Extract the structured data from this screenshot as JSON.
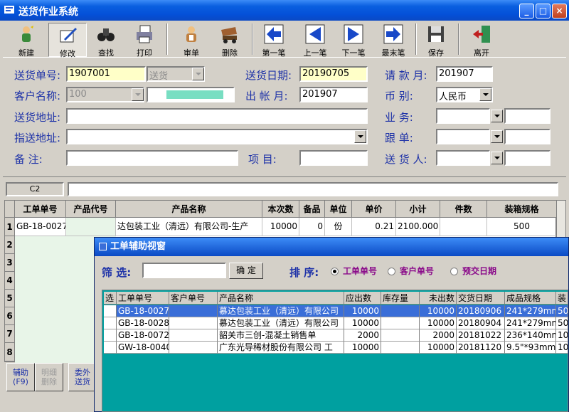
{
  "window": {
    "title": "送货作业系统"
  },
  "toolbar": [
    {
      "key": "new",
      "label": "新建"
    },
    {
      "key": "edit",
      "label": "修改"
    },
    {
      "key": "find",
      "label": "查找"
    },
    {
      "key": "print",
      "label": "打印"
    },
    {
      "key": "audit",
      "label": "审单"
    },
    {
      "key": "delete",
      "label": "删除"
    },
    {
      "key": "first",
      "label": "第一笔"
    },
    {
      "key": "prev",
      "label": "上一笔"
    },
    {
      "key": "next",
      "label": "下一笔"
    },
    {
      "key": "last",
      "label": "最末笔"
    },
    {
      "key": "save",
      "label": "保存"
    },
    {
      "key": "exit",
      "label": "离开"
    }
  ],
  "form": {
    "delivery_no": {
      "label": "送货单号:",
      "value": "1907001"
    },
    "delivery_type": {
      "value": "送货"
    },
    "delivery_date": {
      "label": "送货日期:",
      "value": "20190705"
    },
    "billing_month": {
      "label": "请 款 月:",
      "value": "201907"
    },
    "customer": {
      "label": "客户名称:",
      "value": "100"
    },
    "invoice_month": {
      "label": "出 帐 月:",
      "value": "201907"
    },
    "currency": {
      "label": "币    别:",
      "value": "人民币"
    },
    "delivery_address": {
      "label": "送货地址:",
      "value": ""
    },
    "sales": {
      "label": "业    务:",
      "value": ""
    },
    "assigned_address": {
      "label": "指送地址:",
      "value": ""
    },
    "follow": {
      "label": "跟    单:",
      "value": ""
    },
    "remark": {
      "label": "备    注:",
      "value": ""
    },
    "project": {
      "label": "项    目:",
      "value": ""
    },
    "deliverer": {
      "label": "送 货 人:",
      "value": ""
    }
  },
  "cell_ref": "C2",
  "grid": {
    "columns": [
      "工单单号",
      "产品代号",
      "产品名称",
      "本次数",
      "备品",
      "单位",
      "单价",
      "小计",
      "件数",
      "装箱规格"
    ],
    "rows": [
      {
        "n": "1",
        "cells": [
          "GB-18-0027",
          "",
          "达包装工业（清远）有限公司-生产",
          "10000",
          "0",
          "份",
          "0.21",
          "2100.000",
          "",
          "500"
        ]
      },
      {
        "n": "2"
      },
      {
        "n": "3"
      },
      {
        "n": "4"
      },
      {
        "n": "5"
      },
      {
        "n": "6"
      },
      {
        "n": "7"
      },
      {
        "n": "8"
      }
    ]
  },
  "side_buttons": [
    {
      "l1": "辅助",
      "l2": "(F9)"
    },
    {
      "l1": "明细",
      "l2": "删除"
    },
    {
      "l1": "委外",
      "l2": "送货"
    }
  ],
  "popup": {
    "title": "工单辅助视窗",
    "filter_label": "筛  选:",
    "filter_value": "",
    "confirm": "确  定",
    "sort_label": "排  序:",
    "sort_options": [
      "工单单号",
      "客户单号",
      "预交日期"
    ],
    "columns": [
      "选",
      "工单单号",
      "客户单号",
      "产品名称",
      "应出数",
      "库存量",
      "未出数",
      "交货日期",
      "成品规格",
      "装"
    ],
    "rows": [
      [
        "",
        "GB-18-0027",
        "",
        "慕达包装工业（清远）有限公司",
        "10000",
        "",
        "10000",
        "20180906",
        "241*279mm",
        "50"
      ],
      [
        "",
        "GB-18-0028",
        "",
        "慕达包装工业（清远）有限公司",
        "10000",
        "",
        "10000",
        "20180904",
        "241*279mm",
        "50"
      ],
      [
        "",
        "GB-18-0072",
        "",
        "韶关市三创-混凝土销售单",
        "2000",
        "",
        "2000",
        "20181022",
        "236*140mm",
        "10"
      ],
      [
        "",
        "GW-18-0040",
        "",
        "广东光导稀材股份有限公司 工",
        "10000",
        "",
        "10000",
        "20181120",
        "9.5\"*93mm",
        "10"
      ]
    ]
  }
}
